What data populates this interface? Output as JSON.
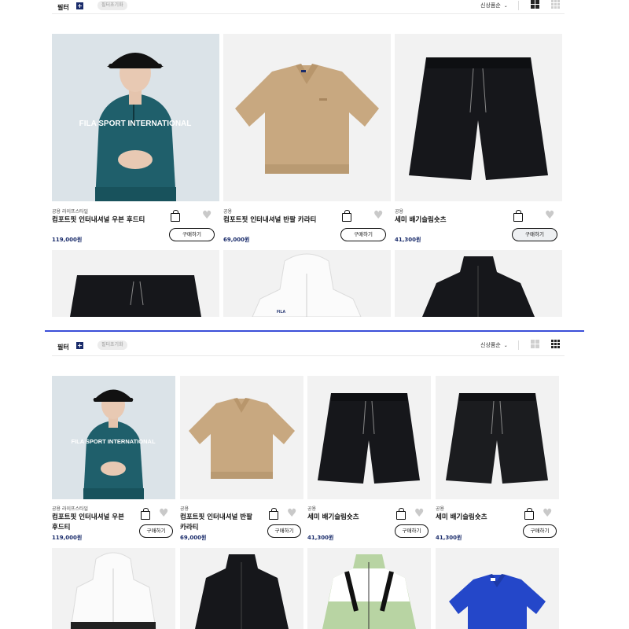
{
  "toolbar": {
    "filter_label": "필터",
    "reset_label": "필터초기화",
    "sort_label": "신상품순",
    "view_large_label": "2열 보기",
    "view_small_label": "4열 보기"
  },
  "products": [
    {
      "category": "공용 라이프스타일",
      "name": "컴포트핏 인터내셔널 우븐 후드티",
      "price": "119,000원",
      "buy_label": "구매하기",
      "image": "model-teal-hoodie",
      "print": "FILA SPORT INTERNATIONAL"
    },
    {
      "category": "공용",
      "name": "컴포트핏 인터내셔널 반팔 카라티",
      "price": "69,000원",
      "buy_label": "구매하기",
      "image": "beige-collar-tee"
    },
    {
      "category": "공용",
      "name": "세미 배기슬림숏츠",
      "price": "41,300원",
      "buy_label": "구매하기",
      "image": "black-shorts"
    },
    {
      "category": "공용",
      "name": "세미 배기슬림숏츠",
      "price": "41,300원",
      "buy_label": "구매하기",
      "image": "black-shorts"
    }
  ],
  "partial_items": [
    {
      "image": "black-shorts"
    },
    {
      "image": "white-windbreaker",
      "logo": "FILA"
    },
    {
      "image": "black-track-jacket"
    },
    {
      "image": "green-white-jacket"
    },
    {
      "image": "blue-polo"
    }
  ],
  "colors": {
    "accent": "#1a2c6b",
    "divider": "#3b4fd8"
  }
}
